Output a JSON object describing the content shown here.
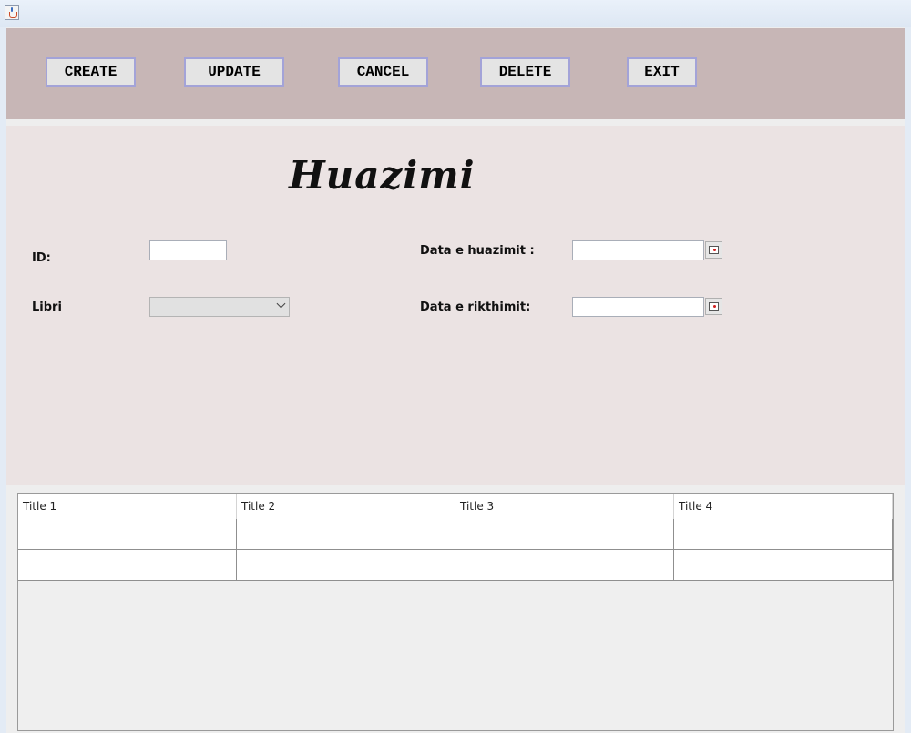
{
  "window": {
    "icon": "java-cup-icon"
  },
  "toolbar": {
    "buttons": [
      {
        "label": "CREATE"
      },
      {
        "label": "UPDATE"
      },
      {
        "label": "CANCEL"
      },
      {
        "label": "DELETE"
      },
      {
        "label": "EXIT"
      }
    ]
  },
  "form": {
    "heading": "Huazimi",
    "id_label": "ID:",
    "id_value": "",
    "libri_label": "Libri",
    "libri_selected": "",
    "data_huazimit_label": "Data e huazimit :",
    "data_huazimit_value": "",
    "data_rikthimit_label": "Data e rikthimit:",
    "data_rikthimit_value": "",
    "calendar_icon": "calendar-icon"
  },
  "table": {
    "columns": [
      "Title 1",
      "Title 2",
      "Title 3",
      "Title 4"
    ],
    "rows": [
      [
        "",
        "",
        "",
        ""
      ],
      [
        "",
        "",
        "",
        ""
      ],
      [
        "",
        "",
        "",
        ""
      ],
      [
        "",
        "",
        "",
        ""
      ]
    ]
  }
}
